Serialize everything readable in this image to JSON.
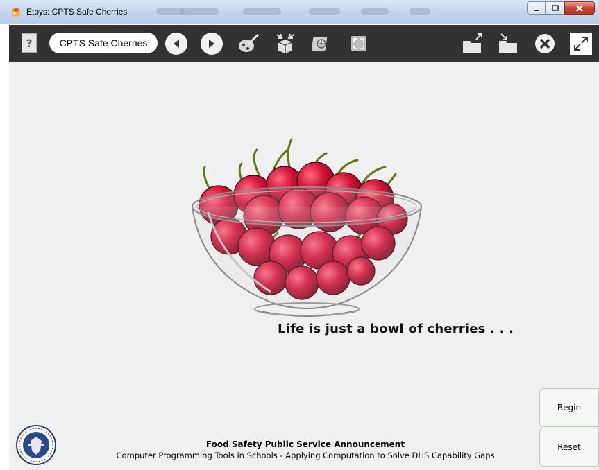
{
  "window": {
    "title": "Etoys: CPTS Safe Cherries",
    "controls": [
      "minimize",
      "maximize",
      "close"
    ]
  },
  "toolbar": {
    "help_label": "?",
    "project_name": "CPTS Safe Cherries",
    "icons": [
      "help-icon",
      "previous-page-icon",
      "next-page-icon",
      "paint-icon",
      "supplies-icon",
      "language-icon",
      "fullscreen-icon",
      "load-project-icon",
      "save-project-icon",
      "stop-icon",
      "expand-icon"
    ]
  },
  "canvas": {
    "tagline": "Life is just a bowl of cherries . . .",
    "footer_title": "Food Safety Public Service Announcement",
    "footer_subtitle": "Computer Programming Tools in Schools - Applying Computation to Solve DHS Capability Gaps",
    "begin_label": "Begin",
    "reset_label": "Reset",
    "seal_text": "U.S. DEPARTMENT OF HOMELAND SECURITY"
  },
  "colors": {
    "toolbar_bg": "#323232",
    "canvas_bg": "#f0f0f0",
    "cherry": "#c8102e"
  }
}
